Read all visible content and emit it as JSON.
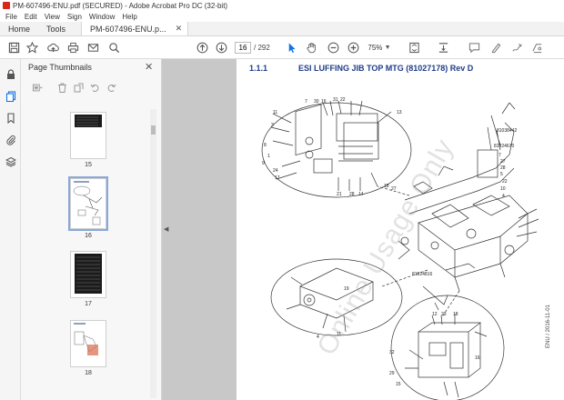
{
  "window": {
    "title": "PM-607496-ENU.pdf (SECURED) - Adobe Acrobat Pro DC (32-bit)"
  },
  "menu": [
    "File",
    "Edit",
    "View",
    "Sign",
    "Window",
    "Help"
  ],
  "tabs": {
    "home": "Home",
    "tools": "Tools",
    "document": "PM-607496-ENU.p..."
  },
  "toolbar": {
    "page_current": "16",
    "page_total": "/ 292",
    "zoom": "75%"
  },
  "thumbnail_panel": {
    "title": "Page Thumbnails",
    "pages": [
      {
        "label": "15",
        "selected": false
      },
      {
        "label": "16",
        "selected": true
      },
      {
        "label": "17",
        "selected": false
      },
      {
        "label": "18",
        "selected": false
      }
    ]
  },
  "document": {
    "section_number": "1.1.1",
    "section_title": "ESI LUFFING JIB TOP MTG (81027178) Rev D",
    "watermark": "Online Usage Only",
    "side_code": "ENU / 2016-11-01",
    "callouts": [
      "11",
      "7",
      "30",
      "16",
      "31",
      "22",
      "13",
      "3",
      "8",
      "1",
      "17",
      "24",
      "9",
      "21",
      "28",
      "14",
      "18",
      "27",
      "81038442",
      "81024670",
      "7",
      "27",
      "28",
      "5",
      "22",
      "10",
      "4",
      "81024816",
      "19",
      "11",
      "4",
      "12",
      "23",
      "18",
      "32",
      "29",
      "15",
      "16"
    ]
  },
  "colors": {
    "accent_blue": "#1473e6",
    "heading_blue": "#1f3c88",
    "acrobat_red": "#d9261c"
  }
}
